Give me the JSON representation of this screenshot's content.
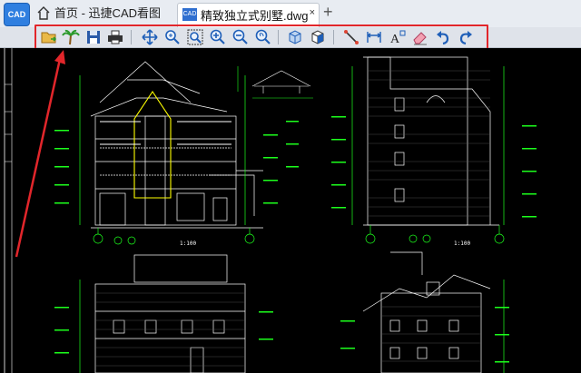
{
  "app": {
    "logo_text": "CAD"
  },
  "tabs": [
    {
      "label": "首页 - 迅捷CAD看图",
      "icon": "home-icon"
    },
    {
      "label": "精致独立式别墅.dwg",
      "icon": "cad-file-icon",
      "close": "×",
      "icon_text": "CAD"
    }
  ],
  "new_tab": "+",
  "toolbar": {
    "buttons": [
      "open-file-icon",
      "palm-tree-icon",
      "save-icon",
      "print-icon",
      "pan-icon",
      "zoom-realtime-icon",
      "zoom-window-icon",
      "zoom-in-icon",
      "zoom-out-icon",
      "zoom-previous-icon",
      "3d-view-icon",
      "3d-orbit-icon",
      "measure-distance-icon",
      "dimension-icon",
      "text-icon",
      "eraser-icon",
      "undo-icon",
      "redo-icon"
    ]
  },
  "drawing": {
    "scale_labels": [
      "1:100",
      "1:100"
    ],
    "accent_color": "#1cff1c",
    "line_color": "#ffffff",
    "highlight_color": "#ffff00",
    "annotation_color": "#e2262b"
  }
}
